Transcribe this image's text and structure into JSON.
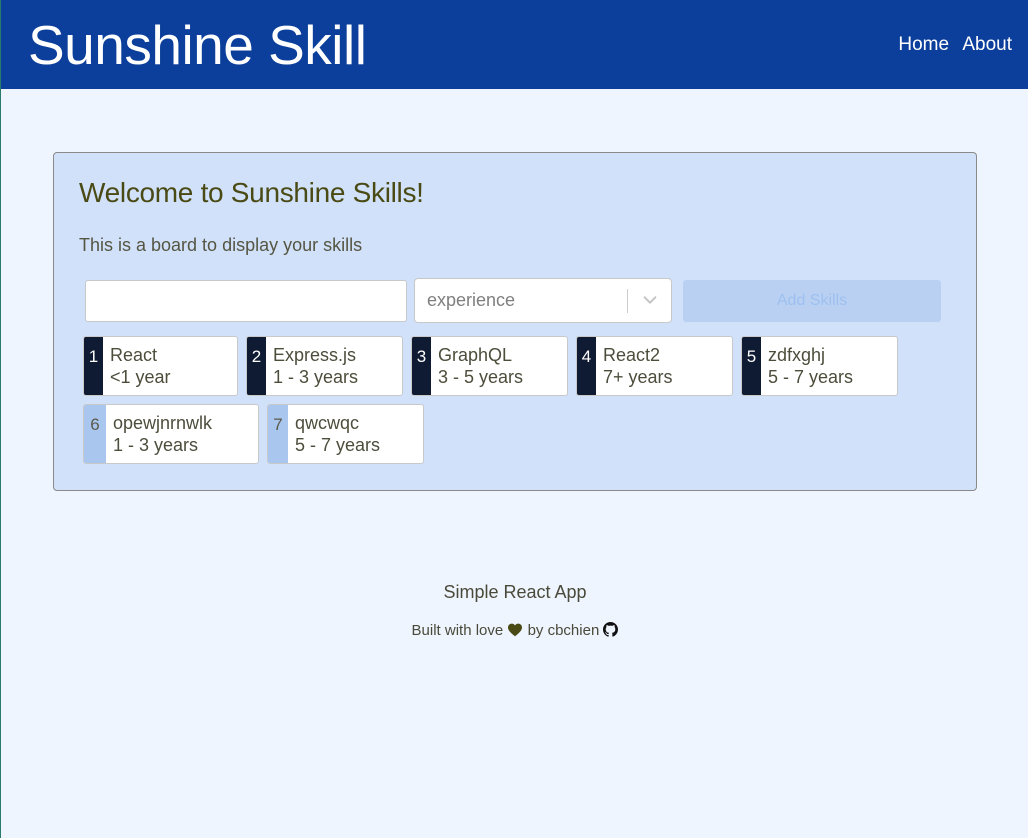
{
  "header": {
    "brand": "Sunshine Skill",
    "nav": [
      {
        "label": "Home"
      },
      {
        "label": "About"
      }
    ]
  },
  "main": {
    "title": "Welcome to Sunshine Skills!",
    "subtitle": "This is a board to display your skills",
    "skill_input": {
      "value": "",
      "placeholder": ""
    },
    "experience_select": {
      "placeholder": "experience"
    },
    "add_button": "Add Skills",
    "skills": [
      {
        "rank": "1",
        "name": "React",
        "experience": "<1 year"
      },
      {
        "rank": "2",
        "name": "Express.js",
        "experience": "1 - 3 years"
      },
      {
        "rank": "3",
        "name": "GraphQL",
        "experience": "3 - 5 years"
      },
      {
        "rank": "4",
        "name": "React2",
        "experience": "7+ years"
      },
      {
        "rank": "5",
        "name": "zdfxghj",
        "experience": "5 - 7 years"
      },
      {
        "rank": "6",
        "name": "opewjnrnwlk",
        "experience": "1 - 3 years"
      },
      {
        "rank": "7",
        "name": "qwcwqc",
        "experience": "5 - 7 years"
      }
    ]
  },
  "footer": {
    "title": "Simple React App",
    "built_with": "Built with love",
    "by": "by",
    "author": "cbchien",
    "icons": [
      "heart-icon",
      "github-icon"
    ]
  },
  "colors": {
    "navbar": "#0c3f9b",
    "page_background": "#eff5ff",
    "card_background": "#d1e1fa",
    "rank_dark": "#0f1b33",
    "rank_light": "#a9c6ef",
    "heading_text": "#4a4a15"
  }
}
